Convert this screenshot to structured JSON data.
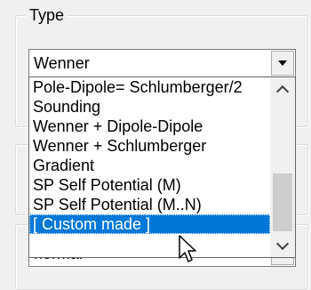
{
  "type_group": {
    "title": "Type",
    "combo_value": "Wenner"
  },
  "dropdown": {
    "items": [
      "Pole-Dipole= Schlumberger/2",
      "Sounding",
      "Wenner + Dipole-Dipole",
      "Wenner + Schlumberger",
      "Gradient",
      "SP Self Potential (M)",
      "SP Self Potential (M..N)",
      "[ Custom made ]"
    ],
    "selected_index": 7
  },
  "lower_combo": {
    "value": "normal"
  },
  "icons": {
    "cursor": "arrow-pointer-icon",
    "up": "chevron-up-icon",
    "down": "chevron-down-icon"
  },
  "colors": {
    "selection": "#0078d7",
    "window": "#f0f0f0"
  }
}
